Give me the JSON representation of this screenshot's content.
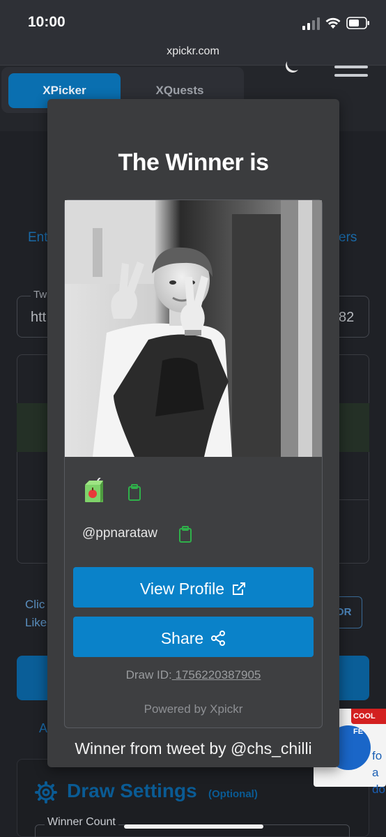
{
  "status_bar": {
    "time": "10:00",
    "icons": [
      "signal-icon",
      "wifi-icon",
      "battery-icon"
    ]
  },
  "browser": {
    "url": "xpickr.com"
  },
  "nav": {
    "tabs": [
      {
        "label": "XPicker",
        "active": true
      },
      {
        "label": "XQuests",
        "active": false
      }
    ],
    "icons": [
      "moon-icon",
      "menu-icon"
    ]
  },
  "background_page": {
    "link_left_fragment": "Ent",
    "link_right_fragment": "ers",
    "input_label_fragment": "Tw",
    "input_value_left_fragment": "htt",
    "input_value_right_fragment": "82",
    "click_text_line1": "Clic",
    "click_text_line2": "Like",
    "side_button_fragment": "OR",
    "a_fragment": "A",
    "draw_settings_title": "Draw Settings",
    "draw_settings_optional": "(Optional)",
    "winner_count_label": "Winner Count"
  },
  "ad": {
    "tag": "COOL FE",
    "text_line1": "fo",
    "text_line2": "a do"
  },
  "modal": {
    "title": "The Winner is",
    "username": "@ppnarataw",
    "view_profile_label": "View Profile",
    "share_label": "Share",
    "draw_id_label": "Draw ID:",
    "draw_id_value": " 1756220387905",
    "powered_by": "Powered by Xpickr",
    "footer": "Winner from tweet by @chs_chilli"
  },
  "colors": {
    "accent": "#0a82c9",
    "modal_bg": "#3b3c3e",
    "clipboard_green": "#2fb04a"
  }
}
